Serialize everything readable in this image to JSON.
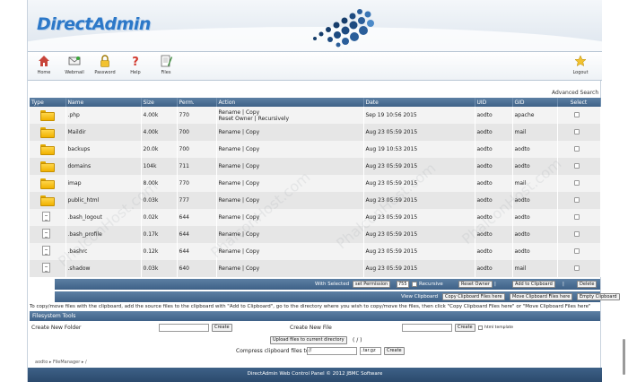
{
  "header": {
    "logo_text": "DirectAdmin"
  },
  "nav": {
    "items": [
      {
        "label": "Home",
        "icon": "home-icon"
      },
      {
        "label": "Webmail",
        "icon": "webmail-icon"
      },
      {
        "label": "Password",
        "icon": "lock-icon"
      },
      {
        "label": "Help",
        "icon": "help-icon"
      },
      {
        "label": "Files",
        "icon": "files-icon"
      }
    ],
    "logout_label": "Logout"
  },
  "advanced_search": "Advanced Search",
  "table": {
    "columns": [
      "Type",
      "Name",
      "Size",
      "Perm.",
      "Action",
      "Date",
      "UID",
      "GID",
      "Select"
    ],
    "rows": [
      {
        "type": "folder",
        "name": ".php",
        "size": "4.00k",
        "perm": "770",
        "action": "Rename | Copy",
        "action2": "Reset Owner | Recursively",
        "date": "Sep 19 10:56 2015",
        "uid": "aodto",
        "gid": "apache"
      },
      {
        "type": "folder",
        "name": "Maildir",
        "size": "4.00k",
        "perm": "700",
        "action": "Rename | Copy",
        "action2": "",
        "date": "Aug 23 05:59 2015",
        "uid": "aodto",
        "gid": "mail"
      },
      {
        "type": "folder",
        "name": "backups",
        "size": "20.0k",
        "perm": "700",
        "action": "Rename | Copy",
        "action2": "",
        "date": "Aug 19 10:53 2015",
        "uid": "aodto",
        "gid": "aodto"
      },
      {
        "type": "folder",
        "name": "domains",
        "size": "104k",
        "perm": "711",
        "action": "Rename | Copy",
        "action2": "",
        "date": "Aug 23 05:59 2015",
        "uid": "aodto",
        "gid": "aodto"
      },
      {
        "type": "folder",
        "name": "imap",
        "size": "8.00k",
        "perm": "770",
        "action": "Rename | Copy",
        "action2": "",
        "date": "Aug 23 05:59 2015",
        "uid": "aodto",
        "gid": "mail"
      },
      {
        "type": "folder-link",
        "name": "public_html",
        "size": "0.03k",
        "perm": "777",
        "action": "Rename | Copy",
        "action2": "",
        "date": "Aug 23 05:59 2015",
        "uid": "aodto",
        "gid": "aodto"
      },
      {
        "type": "file",
        "name": ".bash_logout",
        "size": "0.02k",
        "perm": "644",
        "action": "Rename | Copy",
        "action2": "",
        "date": "Aug 23 05:59 2015",
        "uid": "aodto",
        "gid": "aodto"
      },
      {
        "type": "file",
        "name": ".bash_profile",
        "size": "0.17k",
        "perm": "644",
        "action": "Rename | Copy",
        "action2": "",
        "date": "Aug 23 05:59 2015",
        "uid": "aodto",
        "gid": "aodto"
      },
      {
        "type": "file",
        "name": ".bashrc",
        "size": "0.12k",
        "perm": "644",
        "action": "Rename | Copy",
        "action2": "",
        "date": "Aug 23 05:59 2015",
        "uid": "aodto",
        "gid": "aodto"
      },
      {
        "type": "file",
        "name": ".shadow",
        "size": "0.03k",
        "perm": "640",
        "action": "Rename | Copy",
        "action2": "",
        "date": "Aug 23 05:59 2015",
        "uid": "aodto",
        "gid": "mail"
      }
    ]
  },
  "selected_bar": {
    "label": "With Selected",
    "set_permission": "set Permission",
    "permission_value": "755",
    "recursive_label": "Recursive",
    "reset_owner": "Reset Owner",
    "add_clipboard": "Add to Clipboard",
    "separator": "|",
    "delete": "Delete"
  },
  "clipboard_bar": {
    "view": "View Clipboard",
    "copy_here": "Copy Clipboard Files here",
    "move_here": "Move Clipboard Files here",
    "empty": "Empty Clipboard"
  },
  "info_text": "To copy/move files with the clipboard, add the source files to the clipboard with \"Add to Clipboard\", go to the directory where you wish to copy/move the files, then click \"Copy Clipboard Files here\" or \"Move Clipboard Files here\"",
  "fs_tools": {
    "title": "Filesystem Tools",
    "create_folder": "Create New Folder",
    "create_file": "Create New File",
    "create_btn": "Create",
    "html_template": "html template",
    "upload_btn": "Upload files to current directory",
    "upload_path": "( / )",
    "compress_label": "Compress clipboard files to",
    "compress_value": "//",
    "compress_ext": ".tar.gz"
  },
  "breadcrumb": "aodto ▸ FileManager ▸ /",
  "footer": "DirectAdmin Web Control Panel © 2012 JBMC Software",
  "watermark": "PhalconHost.com"
}
